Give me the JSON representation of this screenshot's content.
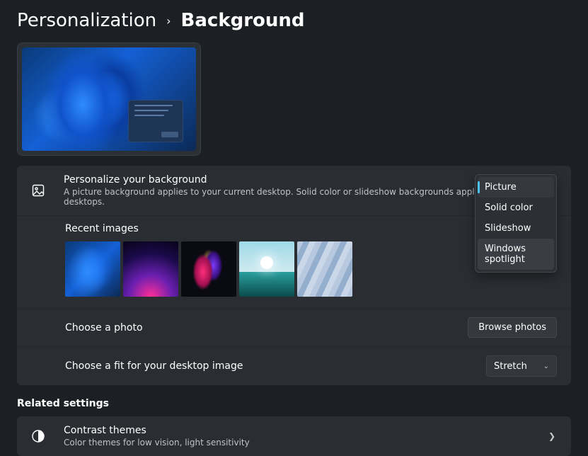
{
  "breadcrumb": {
    "parent": "Personalization",
    "current": "Background"
  },
  "personalize": {
    "title": "Personalize your background",
    "desc": "A picture background applies to your current desktop. Solid color or slideshow backgrounds apply to all your desktops.",
    "selected_option": "Picture",
    "options": [
      "Picture",
      "Solid color",
      "Slideshow",
      "Windows spotlight"
    ]
  },
  "recent": {
    "label": "Recent images"
  },
  "choose_photo": {
    "label": "Choose a photo",
    "button": "Browse photos"
  },
  "choose_fit": {
    "label": "Choose a fit for your desktop image",
    "value": "Stretch"
  },
  "related": {
    "header": "Related settings",
    "contrast": {
      "title": "Contrast themes",
      "desc": "Color themes for low vision, light sensitivity"
    }
  }
}
